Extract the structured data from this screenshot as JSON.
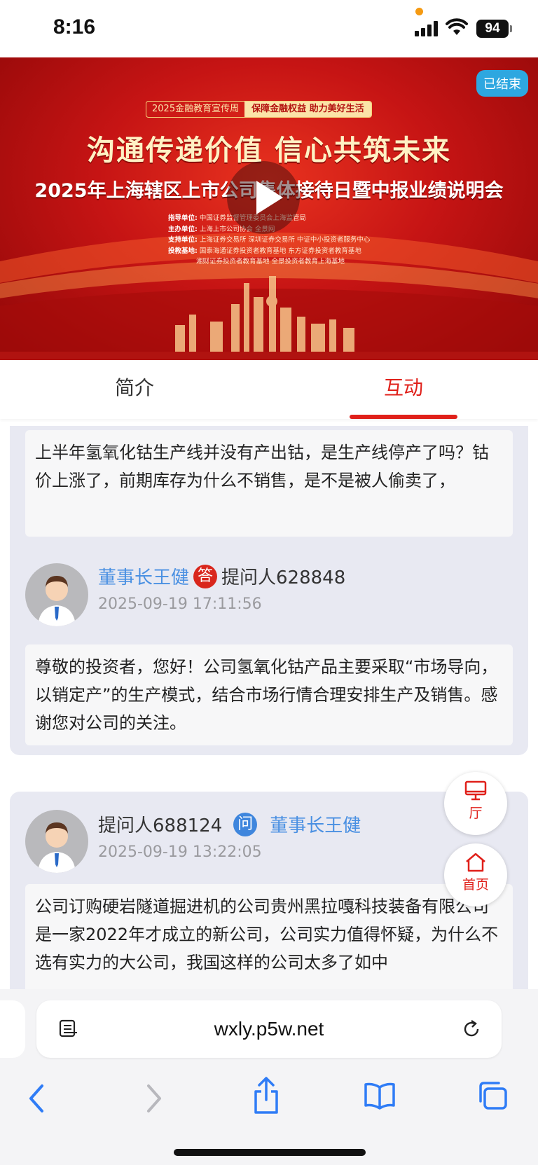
{
  "status_bar": {
    "time": "8:16",
    "battery": "94"
  },
  "banner": {
    "ended_label": "已结束",
    "campaign_tag": "2025金融教育宣传周",
    "campaign_slogan": "保障金融权益  助力美好生活",
    "slogan": "沟通传递价值  信心共筑未来",
    "title": "2025年上海辖区上市公司集体接待日暨中报业绩说明会",
    "org_lines": [
      {
        "label": "指导单位:",
        "text": "中国证券监督管理委员会上海监管局"
      },
      {
        "label": "主办单位:",
        "text": "上海上市公司协会  全景网"
      },
      {
        "label": "支持单位:",
        "text": "上海证券交易所  深圳证券交易所  中证中小投资者服务中心"
      },
      {
        "label": "投教基地:",
        "text": "国泰海通证券投资者教育基地  东方证券投资者教育基地"
      },
      {
        "label": "",
        "text": "湘财证券投资者教育基地  全景投资者教育上海基地"
      }
    ]
  },
  "tabs": [
    {
      "label": "简介",
      "active": false
    },
    {
      "label": "互动",
      "active": true
    }
  ],
  "thread1": {
    "question": "上半年氢氧化钴生产线并没有产出钴，是生产线停产了吗？钴价上涨了，前期库存为什么不销售，是不是被人偷卖了，",
    "answerer": "董事长王健",
    "answer_badge": "答",
    "asker": "提问人628848",
    "timestamp": "2025-09-19 17:11:56",
    "answer": "尊敬的投资者，您好！公司氢氧化钴产品主要采取“市场导向，以销定产”的生产模式，结合市场行情合理安排生产及销售。感谢您对公司的关注。"
  },
  "thread2": {
    "asker": "提问人688124",
    "ask_badge": "问",
    "addressee": "董事长王健",
    "timestamp": "2025-09-19 13:22:05",
    "question": "公司订购硬岩隧道掘进机的公司贵州黑拉嘎科技装备有限公司是一家2022年才成立的新公司，公司实力值得怀疑，为什么不选有实力的大公司，我国这样的公司太多了如中"
  },
  "float_buttons": {
    "hall": "厅",
    "home": "首页"
  },
  "browser": {
    "url": "wxly.p5w.net"
  },
  "colors": {
    "accent_red": "#e0201a",
    "link_blue": "#4a90e2",
    "card_bg": "#e8e9f2"
  }
}
